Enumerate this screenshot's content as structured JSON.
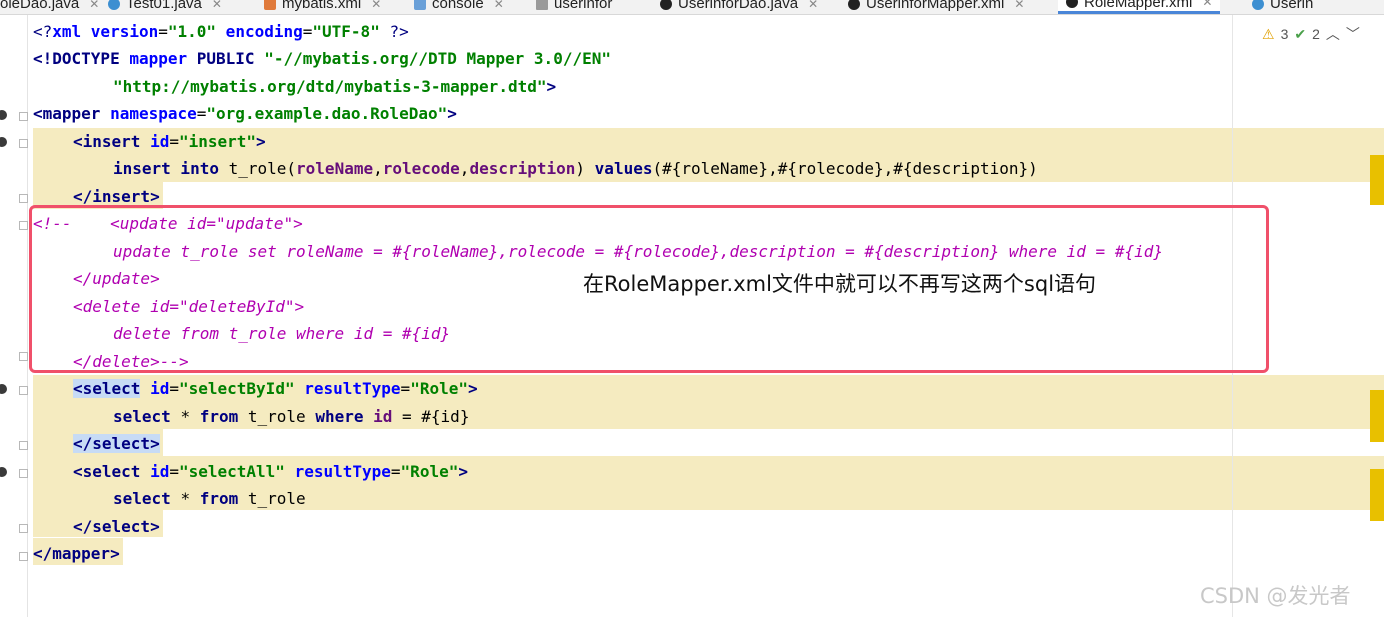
{
  "tabs": [
    {
      "label": "oleDao.java",
      "icon": "java-interface-icon",
      "active": false
    },
    {
      "label": "Test01.java",
      "icon": "java-class-icon",
      "active": false
    },
    {
      "label": "mybatis.xml",
      "icon": "xml-file-icon",
      "active": false
    },
    {
      "label": "console",
      "icon": "console-icon",
      "active": false
    },
    {
      "label": "userinfor",
      "icon": "table-icon",
      "active": false
    },
    {
      "label": "UserinforDao.java",
      "icon": "java-interface-icon",
      "active": false
    },
    {
      "label": "UserinforMapper.xml",
      "icon": "mybatis-xml-icon",
      "active": false
    },
    {
      "label": "RoleMapper.xml",
      "icon": "mybatis-xml-icon",
      "active": true
    },
    {
      "label": "Userin",
      "icon": "java-class-icon",
      "active": false
    }
  ],
  "inspection": {
    "warnings": "3",
    "weak_warnings": "2"
  },
  "code": {
    "l1": {
      "a": "<?",
      "b": "xml ",
      "c": "version",
      "d": "=",
      "e": "\"1.0\"",
      "f": " encoding",
      "g": "=",
      "h": "\"UTF-8\"",
      "i": " ?>"
    },
    "l2": {
      "a": "<!DOCTYPE ",
      "b": "mapper ",
      "c": "PUBLIC ",
      "d": "\"-//mybatis.org//DTD Mapper 3.0//EN\""
    },
    "l3": {
      "a": "\"http://mybatis.org/dtd/mybatis-3-mapper.dtd\"",
      "b": ">"
    },
    "l4": {
      "a": "<mapper ",
      "b": "namespace",
      "c": "=",
      "d": "\"org.example.dao.RoleDao\"",
      "e": ">"
    },
    "l5": {
      "a": "<insert ",
      "b": "id",
      "c": "=",
      "d": "\"insert\"",
      "e": ">"
    },
    "l6": {
      "a": "insert into ",
      "b": "t_role(",
      "c": "roleName",
      "d": ",",
      "e": "rolecode",
      "f": ",",
      "g": "description",
      "h": ") ",
      "i": "values",
      "j": "(#{roleName},#{rolecode},#{description})"
    },
    "l7": {
      "a": "</insert>"
    },
    "l8": {
      "a": "<!--    <update id=\"update\">"
    },
    "l9": {
      "a": "update t_role set roleName = #{roleName},rolecode = #{rolecode},description = #{description} where id = #{id}"
    },
    "l10": {
      "a": "</update>"
    },
    "l11": {
      "a": "<delete id=\"deleteById\">"
    },
    "l12": {
      "a": "delete from t_role where id = #{id}"
    },
    "l13": {
      "a": "</delete>-->"
    },
    "l14": {
      "a": "<select",
      "b": " id",
      "c": "=",
      "d": "\"selectById\"",
      "e": " resultType",
      "f": "=",
      "g": "\"Role\"",
      "h": ">"
    },
    "l15": {
      "a": "select ",
      "b": "* ",
      "c": "from ",
      "d": "t_role ",
      "e": "where ",
      "f": "id ",
      "g": "= #{id}"
    },
    "l16": {
      "a": "</select>"
    },
    "l17": {
      "a": "<select ",
      "b": "id",
      "c": "=",
      "d": "\"selectAll\"",
      "e": " resultType",
      "f": "=",
      "g": "\"Role\"",
      "h": ">"
    },
    "l18": {
      "a": "select ",
      "b": "* ",
      "c": "from ",
      "d": "t_role"
    },
    "l19": {
      "a": "</select>"
    },
    "l20": {
      "a": "</mapper>"
    }
  },
  "annotation": "在RoleMapper.xml文件中就可以不再写这两个sql语句",
  "watermark": "CSDN @发光者",
  "colors": {
    "highlight": "#f5ebc0",
    "selection": "#c7dbf5",
    "annotation_box": "#f0506a",
    "marker": "#e8c000"
  }
}
